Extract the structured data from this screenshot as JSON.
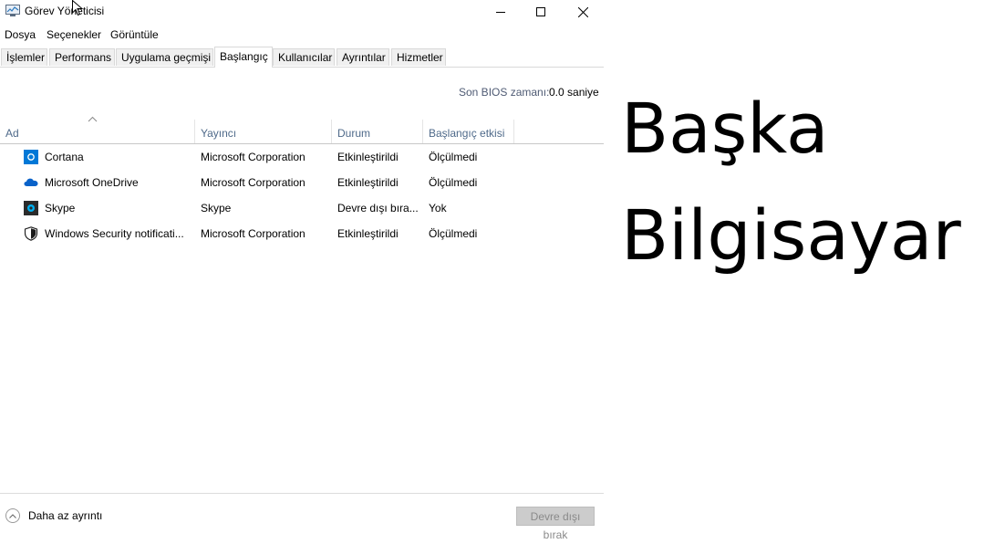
{
  "window": {
    "title": "Görev Yöneticisi",
    "controls": [
      "minimize",
      "maximize",
      "close"
    ]
  },
  "menu": [
    "Dosya",
    "Seçenekler",
    "Görüntüle"
  ],
  "tabs": [
    {
      "label": "İşlemler"
    },
    {
      "label": "Performans"
    },
    {
      "label": "Uygulama geçmişi"
    },
    {
      "label": "Başlangıç",
      "active": true
    },
    {
      "label": "Kullanıcılar"
    },
    {
      "label": "Ayrıntılar"
    },
    {
      "label": "Hizmetler"
    }
  ],
  "bios": {
    "label": "Son BIOS zamanı:",
    "value": "0.0 saniye"
  },
  "columns": [
    "Ad",
    "Yayıncı",
    "Durum",
    "Başlangıç etkisi"
  ],
  "sort": {
    "column": "Ad",
    "direction": "ascending"
  },
  "rows": [
    {
      "icon": "cortana-icon",
      "name": "Cortana",
      "publisher": "Microsoft Corporation",
      "status": "Etkinleştirildi",
      "impact": "Ölçülmedi"
    },
    {
      "icon": "onedrive-icon",
      "name": "Microsoft OneDrive",
      "publisher": "Microsoft Corporation",
      "status": "Etkinleştirildi",
      "impact": "Ölçülmedi"
    },
    {
      "icon": "skype-icon",
      "name": "Skype",
      "publisher": "Skype",
      "status": "Devre dışı bıra...",
      "impact": "Yok"
    },
    {
      "icon": "shield-icon",
      "name": "Windows Security notificati...",
      "publisher": "Microsoft Corporation",
      "status": "Etkinleştirildi",
      "impact": "Ölçülmedi"
    }
  ],
  "footer": {
    "less_details": "Daha az ayrıntı",
    "disable_button": "Devre dışı bırak"
  },
  "overlay": {
    "line1": "Başka",
    "line2": "Bilgisayar"
  },
  "colors": {
    "tab_border": "#d9d9d9",
    "header_text": "#4f6a8a",
    "cortana_blue": "#0078d7",
    "onedrive_blue": "#0a62c9"
  }
}
